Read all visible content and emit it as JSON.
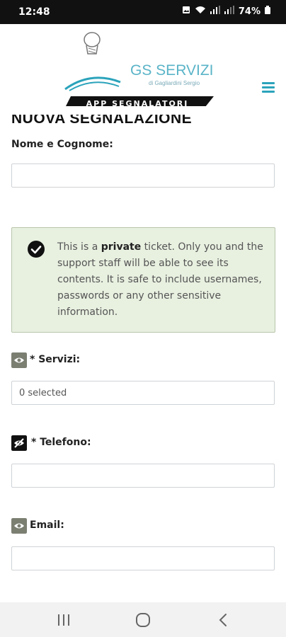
{
  "status_bar": {
    "time": "12:48",
    "battery": "74%"
  },
  "header": {
    "logo_brand": "GS SERVIZI",
    "logo_owner": "di Gagliardini Sergio",
    "logo_banner": "APP SEGNALATORI"
  },
  "page": {
    "title": "NUOVA SEGNALAZIONE"
  },
  "form": {
    "name_label": "Nome e Cognome:",
    "name_value": "",
    "notice": {
      "before": "This is a ",
      "strong": "private",
      "after": " ticket. Only you and the support staff will be able to see its contents. It is safe to include usernames, passwords or any other sensitive information."
    },
    "servizi_label": "* Servizi:",
    "servizi_value": "0 selected",
    "telefono_label": "* Telefono:",
    "telefono_value": "",
    "email_label": "Email:",
    "email_value": ""
  },
  "colors": {
    "accent": "#2ba3bb",
    "notice_bg": "#e8f0e0",
    "visible_icon_bg": "#7b7f72",
    "hidden_icon_bg": "#111111"
  },
  "icons": {
    "servizi_visibility": "eye-icon",
    "telefono_visibility": "eye-slash-icon",
    "email_visibility": "eye-icon",
    "notice": "check-circle-icon"
  }
}
